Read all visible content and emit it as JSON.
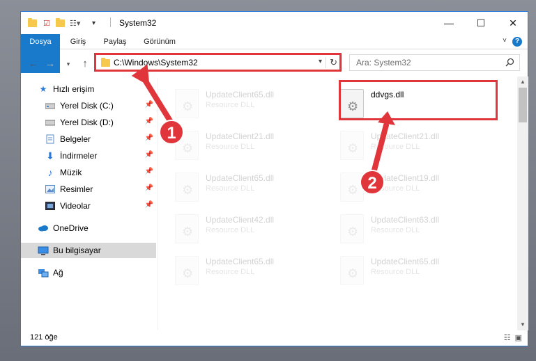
{
  "window": {
    "title": "System32",
    "minimize_glyph": "—",
    "maximize_glyph": "☐",
    "close_glyph": "✕"
  },
  "ribbon": {
    "tabs": [
      "Dosya",
      "Giriş",
      "Paylaş",
      "Görünüm"
    ],
    "help_glyph": "?"
  },
  "navigation": {
    "address": "C:\\Windows\\System32",
    "search_placeholder": "Ara: System32"
  },
  "sidebar": {
    "items": [
      {
        "label": "Hızlı erişim",
        "icon": "star-icon"
      },
      {
        "label": "Yerel Disk (C:)",
        "icon": "drive-icon"
      },
      {
        "label": "Yerel Disk (D:)",
        "icon": "drive-icon"
      },
      {
        "label": "Belgeler",
        "icon": "documents-icon"
      },
      {
        "label": "İndirmeler",
        "icon": "download-icon"
      },
      {
        "label": "Müzik",
        "icon": "music-icon"
      },
      {
        "label": "Resimler",
        "icon": "pictures-icon"
      },
      {
        "label": "Videolar",
        "icon": "videos-icon"
      },
      {
        "label": "OneDrive",
        "icon": "cloud-icon"
      },
      {
        "label": "Bu bilgisayar",
        "icon": "computer-icon"
      },
      {
        "label": "Ağ",
        "icon": "network-icon"
      }
    ]
  },
  "files": [
    {
      "name": "UpdateClient65.dll",
      "type": "Resource DLL",
      "faded": true
    },
    {
      "name": "ddvgs.dll",
      "type": "",
      "faded": false
    },
    {
      "name": "UpdateClient21.dll",
      "type": "Resource DLL",
      "faded": true
    },
    {
      "name": "UpdateClient21.dll",
      "type": "Resource DLL",
      "faded": true
    },
    {
      "name": "UpdateClient65.dll",
      "type": "Resource DLL",
      "faded": true
    },
    {
      "name": "UpdateClient19.dll",
      "type": "Resource DLL",
      "faded": true
    },
    {
      "name": "UpdateClient42.dll",
      "type": "Resource DLL",
      "faded": true
    },
    {
      "name": "UpdateClient63.dll",
      "type": "Resource DLL",
      "faded": true
    },
    {
      "name": "UpdateClient65.dll",
      "type": "Resource DLL",
      "faded": true
    },
    {
      "name": "UpdateClient65.dll",
      "type": "Resource DLL",
      "faded": true
    }
  ],
  "status": {
    "item_count": "121 öğe"
  },
  "callouts": [
    "1",
    "2"
  ],
  "colors": {
    "accent": "#1979ca",
    "highlight": "#e0353a",
    "folder": "#f6c94e"
  }
}
